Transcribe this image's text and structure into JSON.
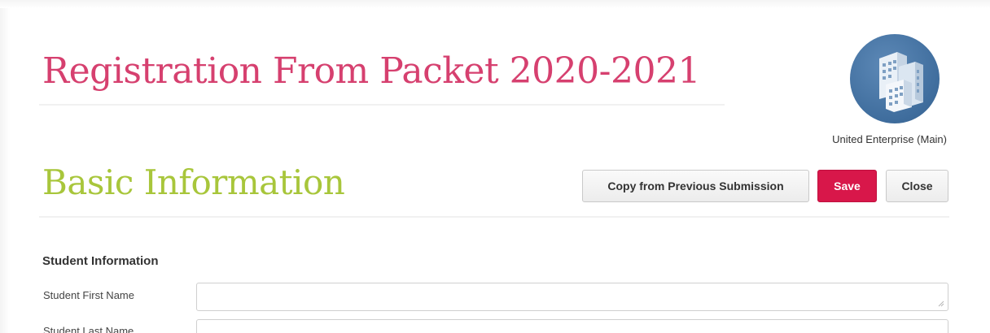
{
  "header": {
    "form_title": "Registration From Packet 2020-2021",
    "organization_name": "United Enterprise (Main)",
    "logo_icon": "buildings-icon"
  },
  "section": {
    "title": "Basic Information",
    "buttons": {
      "copy_label": "Copy from Previous Submission",
      "save_label": "Save",
      "close_label": "Close"
    }
  },
  "student_information": {
    "heading": "Student Information",
    "fields": [
      {
        "label": "Student First Name",
        "value": "",
        "placeholder": ""
      },
      {
        "label": "Student Last Name",
        "value": "",
        "placeholder": ""
      }
    ]
  },
  "colors": {
    "form_title": "#d6406f",
    "section_title": "#a8c63b",
    "save_button": "#d8174a",
    "logo_background": "#3f6d9d"
  }
}
